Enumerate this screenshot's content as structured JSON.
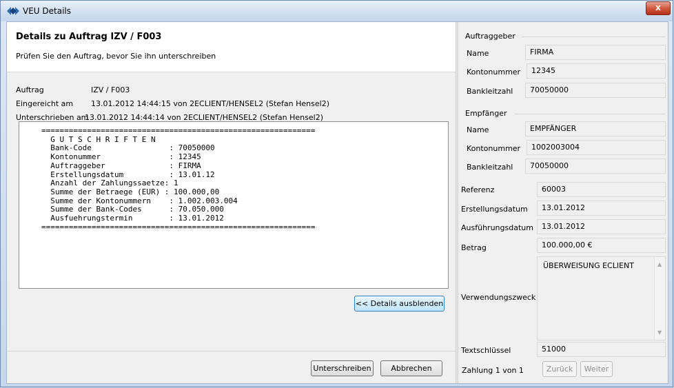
{
  "window": {
    "title": "VEU Details",
    "close_label": "x"
  },
  "header": {
    "title": "Details zu Auftrag IZV / F003",
    "subtitle": "Prüfen Sie den Auftrag, bevor Sie ihn unterschreiben"
  },
  "info": {
    "auftrag_label": "Auftrag",
    "auftrag_value": "IZV / F003",
    "eingereicht_label": "Eingereicht am",
    "eingereicht_value": "13.01.2012 14:44:15 von 2ECLIENT/HENSEL2  (Stefan Hensel2)",
    "unterschrieben_label": "Unterschrieben am",
    "unterschrieben_value": "13.01.2012 14:44:14 von 2ECLIENT/HENSEL2  (Stefan Hensel2)"
  },
  "details_text": "============================================================\n  G U T S C H R I F T E N\n  Bank-Code                 : 70050000\n  Kontonummer               : 12345\n  Auftraggeber              : FIRMA\n  Erstellungsdatum          : 13.01.12\n  Anzahl der Zahlungssaetze: 1\n  Summe der Betraege (EUR) : 100.000,00\n  Summe der Kontonummern    : 1.002.003.004\n  Summe der Bank-Codes      : 70.050.000\n  Ausfuehrungstermin        : 13.01.2012\n============================================================",
  "buttons": {
    "details_toggle": "<< Details ausblenden",
    "sign": "Unterschreiben",
    "cancel": "Abbrechen",
    "back": "Zurück",
    "next": "Weiter"
  },
  "auftraggeber": {
    "group_label": "Auftraggeber",
    "name_label": "Name",
    "name_value": "FIRMA",
    "konto_label": "Kontonummer",
    "konto_value": "12345",
    "blz_label": "Bankleitzahl",
    "blz_value": "70050000"
  },
  "empfaenger": {
    "group_label": "Empfänger",
    "name_label": "Name",
    "name_value": "EMPFÄNGER",
    "konto_label": "Kontonummer",
    "konto_value": "1002003004",
    "blz_label": "Bankleitzahl",
    "blz_value": "70050000"
  },
  "payment": {
    "referenz_label": "Referenz",
    "referenz_value": "60003",
    "erstellungsdatum_label": "Erstellungsdatum",
    "erstellungsdatum_value": "13.01.2012",
    "ausfuehrungsdatum_label": "Ausführungsdatum",
    "ausfuehrungsdatum_value": "13.01.2012",
    "betrag_label": "Betrag",
    "betrag_value": "100.000,00 €",
    "verwendungszweck_label": "Verwendungszweck",
    "verwendungszweck_value": "ÜBERWEISUNG ECLIENT",
    "textschluessel_label": "Textschlüssel",
    "textschluessel_value": "51000",
    "zahlung_label": "Zahlung 1 von 1"
  }
}
